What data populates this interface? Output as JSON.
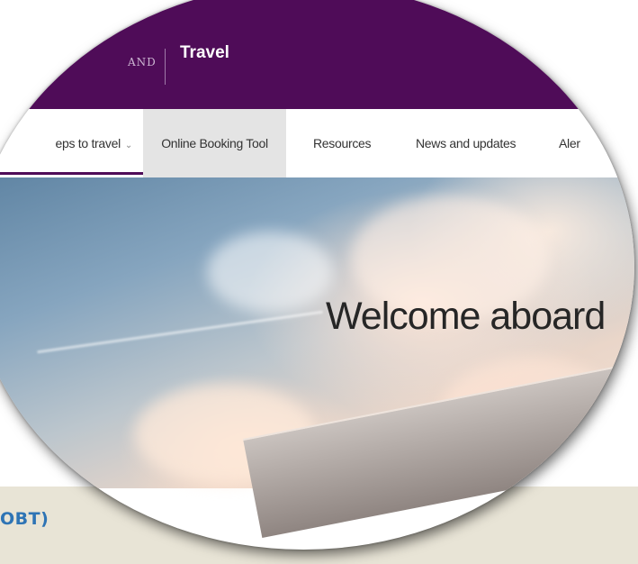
{
  "header": {
    "brand_partial": "AND",
    "site_name": "Travel",
    "background_color": "#4f0c58"
  },
  "nav": {
    "items": [
      {
        "label": "eps to travel",
        "has_dropdown": true,
        "chevron": "chevron-down-icon"
      },
      {
        "label": "Online Booking Tool",
        "highlighted": true
      },
      {
        "label": "Resources"
      },
      {
        "label": "News and updates"
      },
      {
        "label": "Aler"
      }
    ]
  },
  "hero": {
    "title": "Welcome aboard"
  },
  "band": {
    "text": "OBT)",
    "text_color": "#2e74b5",
    "background_color": "#e8e4d6"
  }
}
